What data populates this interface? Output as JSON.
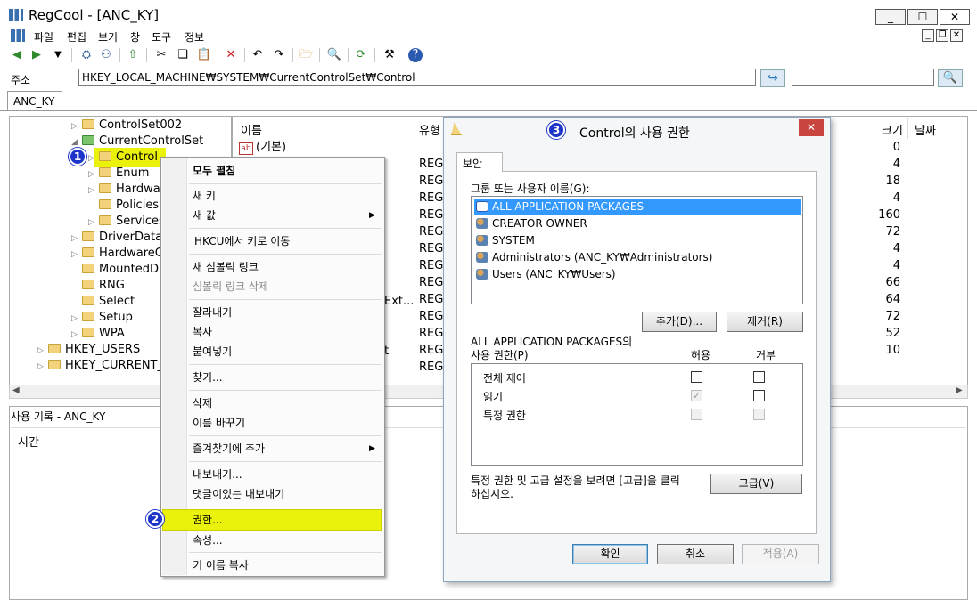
{
  "window": {
    "title": "RegCool - [ANC_KY]",
    "minimize": "_",
    "maximize": "☐",
    "close": "✕"
  },
  "menu": [
    "파일",
    "편집",
    "보기",
    "창",
    "도구",
    "정보"
  ],
  "address": {
    "label": "주소",
    "value": "HKEY_LOCAL_MACHINE₩SYSTEM₩CurrentControlSet₩Control"
  },
  "tab": "ANC_KY",
  "tree": [
    {
      "label": "ControlSet002",
      "expand": "▷"
    },
    {
      "label": "CurrentControlSet",
      "expand": "◢"
    },
    {
      "label": "Control",
      "expand": "▷"
    },
    {
      "label": "Enum",
      "expand": "▷"
    },
    {
      "label": "Hardwa",
      "expand": "▷"
    },
    {
      "label": "Policies",
      "expand": ""
    },
    {
      "label": "Services",
      "expand": "▷"
    },
    {
      "label": "DriverDatab",
      "expand": "▷"
    },
    {
      "label": "HardwareC",
      "expand": "▷"
    },
    {
      "label": "MountedD",
      "expand": ""
    },
    {
      "label": "RNG",
      "expand": ""
    },
    {
      "label": "Select",
      "expand": ""
    },
    {
      "label": "Setup",
      "expand": "▷"
    },
    {
      "label": "WPA",
      "expand": "▷"
    },
    {
      "label": "HKEY_USERS",
      "expand": "▷"
    },
    {
      "label": "HKEY_CURRENT_",
      "expand": "▷"
    }
  ],
  "list": {
    "columns": {
      "name": "이름",
      "type": "유형",
      "size": "크기",
      "date": "날짜"
    },
    "first_name": "(기본)",
    "ext_fragment": "Ext...",
    "t_fragment": "t",
    "types": [
      "REG_",
      "REG_",
      "REG_",
      "REG_",
      "REG_",
      "REG_",
      "REG_",
      "REG_",
      "REG_",
      "REG_",
      "REG_",
      "REG_",
      "REG_"
    ],
    "sizes": [
      "0",
      "4",
      "18",
      "4",
      "160",
      "72",
      "4",
      "4",
      "66",
      "64",
      "72",
      "52",
      "10"
    ]
  },
  "history": {
    "title": "사용 기록 - ANC_KY",
    "time_col": "시간"
  },
  "context_menu": {
    "expand_all": "모두 펼침",
    "new_key": "새 키",
    "new_value": "새 값",
    "goto_hkcu": "HKCU에서 키로 이동",
    "new_symlink": "새 심볼릭 링크",
    "delete_symlink": "심볼릭 링크 삭제",
    "cut": "잘라내기",
    "copy": "복사",
    "paste": "붙여넣기",
    "find": "찾기...",
    "delete": "삭제",
    "rename": "이름 바꾸기",
    "add_favorite": "즐겨찾기에 추가",
    "export": "내보내기...",
    "export_comments": "댓글이있는 내보내기",
    "permissions": "권한...",
    "properties": "속성...",
    "copy_key_name": "키 이름 복사"
  },
  "badges": [
    "1",
    "2",
    "3"
  ],
  "dialog": {
    "title": "Control의 사용 권한",
    "close": "✕",
    "tab": "보안",
    "group_label": "그룹 또는 사용자 이름(G):",
    "users": [
      "ALL APPLICATION PACKAGES",
      "CREATOR OWNER",
      "SYSTEM",
      "Administrators (ANC_KY₩Administrators)",
      "Users (ANC_KY₩Users)"
    ],
    "add_button": "추가(D)...",
    "remove_button": "제거(R)",
    "perm_label_1": "ALL APPLICATION PACKAGES의",
    "perm_label_2": "사용 권한(P)",
    "allow": "허용",
    "deny": "거부",
    "permissions": [
      {
        "name": "전체 제어",
        "allow": false,
        "deny": false
      },
      {
        "name": "읽기",
        "allow": true,
        "deny": false
      },
      {
        "name": "특정 권한",
        "allow": false,
        "deny": false
      }
    ],
    "advanced_text_1": "특정 권한 및 고급 설정을 보려면 [고급]을 클릭",
    "advanced_text_2": "하십시오.",
    "advanced_button": "고급(V)",
    "ok_button": "확인",
    "cancel_button": "취소",
    "apply_button": "적용(A)"
  },
  "colors": {
    "highlight_yellow": "#eaf10a",
    "badge_blue": "#1c35c8",
    "selection_blue": "#3399ff",
    "close_red": "#c94640"
  }
}
